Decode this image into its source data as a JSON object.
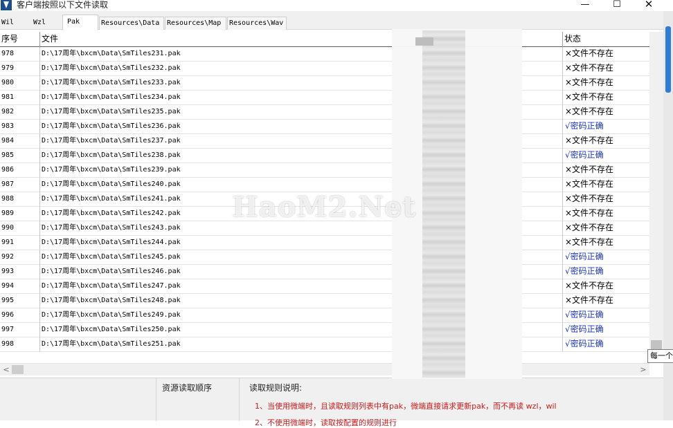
{
  "window": {
    "title": "客户端按照以下文件读取",
    "minimize_glyph": "—",
    "maximize_glyph": "☐",
    "close_glyph": "✕",
    "icon": "app-v-logo-icon"
  },
  "tabs": [
    {
      "label": "Wil",
      "active": false
    },
    {
      "label": "Wzl",
      "active": false
    },
    {
      "label": "Pak",
      "active": true
    },
    {
      "label": "Resources\\Data",
      "active": false
    },
    {
      "label": "Resources\\Map",
      "active": false
    },
    {
      "label": "Resources\\Wav",
      "active": false
    }
  ],
  "grid": {
    "columns": {
      "no": "序号",
      "file": "文件",
      "status": "状态"
    },
    "rows": [
      {
        "no": "978",
        "file": "D:\\17周年\\bxcm\\Data\\SmTiles231.pak",
        "status": "×文件不存在",
        "ok": false
      },
      {
        "no": "979",
        "file": "D:\\17周年\\bxcm\\Data\\SmTiles232.pak",
        "status": "×文件不存在",
        "ok": false
      },
      {
        "no": "980",
        "file": "D:\\17周年\\bxcm\\Data\\SmTiles233.pak",
        "status": "×文件不存在",
        "ok": false
      },
      {
        "no": "981",
        "file": "D:\\17周年\\bxcm\\Data\\SmTiles234.pak",
        "status": "×文件不存在",
        "ok": false
      },
      {
        "no": "982",
        "file": "D:\\17周年\\bxcm\\Data\\SmTiles235.pak",
        "status": "×文件不存在",
        "ok": false
      },
      {
        "no": "983",
        "file": "D:\\17周年\\bxcm\\Data\\SmTiles236.pak",
        "status": "√密码正确",
        "ok": true
      },
      {
        "no": "984",
        "file": "D:\\17周年\\bxcm\\Data\\SmTiles237.pak",
        "status": "×文件不存在",
        "ok": false
      },
      {
        "no": "985",
        "file": "D:\\17周年\\bxcm\\Data\\SmTiles238.pak",
        "status": "√密码正确",
        "ok": true
      },
      {
        "no": "986",
        "file": "D:\\17周年\\bxcm\\Data\\SmTiles239.pak",
        "status": "×文件不存在",
        "ok": false
      },
      {
        "no": "987",
        "file": "D:\\17周年\\bxcm\\Data\\SmTiles240.pak",
        "status": "×文件不存在",
        "ok": false
      },
      {
        "no": "988",
        "file": "D:\\17周年\\bxcm\\Data\\SmTiles241.pak",
        "status": "×文件不存在",
        "ok": false
      },
      {
        "no": "989",
        "file": "D:\\17周年\\bxcm\\Data\\SmTiles242.pak",
        "status": "×文件不存在",
        "ok": false
      },
      {
        "no": "990",
        "file": "D:\\17周年\\bxcm\\Data\\SmTiles243.pak",
        "status": "×文件不存在",
        "ok": false
      },
      {
        "no": "991",
        "file": "D:\\17周年\\bxcm\\Data\\SmTiles244.pak",
        "status": "×文件不存在",
        "ok": false
      },
      {
        "no": "992",
        "file": "D:\\17周年\\bxcm\\Data\\SmTiles245.pak",
        "status": "√密码正确",
        "ok": true
      },
      {
        "no": "993",
        "file": "D:\\17周年\\bxcm\\Data\\SmTiles246.pak",
        "status": "√密码正确",
        "ok": true
      },
      {
        "no": "994",
        "file": "D:\\17周年\\bxcm\\Data\\SmTiles247.pak",
        "status": "×文件不存在",
        "ok": false
      },
      {
        "no": "995",
        "file": "D:\\17周年\\bxcm\\Data\\SmTiles248.pak",
        "status": "×文件不存在",
        "ok": false
      },
      {
        "no": "996",
        "file": "D:\\17周年\\bxcm\\Data\\SmTiles249.pak",
        "status": "√密码正确",
        "ok": true
      },
      {
        "no": "997",
        "file": "D:\\17周年\\bxcm\\Data\\SmTiles250.pak",
        "status": "√密码正确",
        "ok": true
      },
      {
        "no": "998",
        "file": "D:\\17周年\\bxcm\\Data\\SmTiles251.pak",
        "status": "√密码正确",
        "ok": true
      }
    ]
  },
  "colors": {
    "status_ok": "#1a34c8",
    "status_missing": "#000000",
    "rule_text": "#d01818",
    "outer_scroll_thumb": "#2f7bd6"
  },
  "tooltip": "每一个",
  "bottom": {
    "order_label": "资源读取顺序",
    "rules_title": "读取规则说明:",
    "rule1": "1、当使用微端时，且读取规则列表中有pak，微端直接请求更新pak，而不再读 wzl，wil",
    "rule2": "2、不使用微端时，读取按配置的规则进行"
  },
  "watermark": "HaoM2.Net"
}
